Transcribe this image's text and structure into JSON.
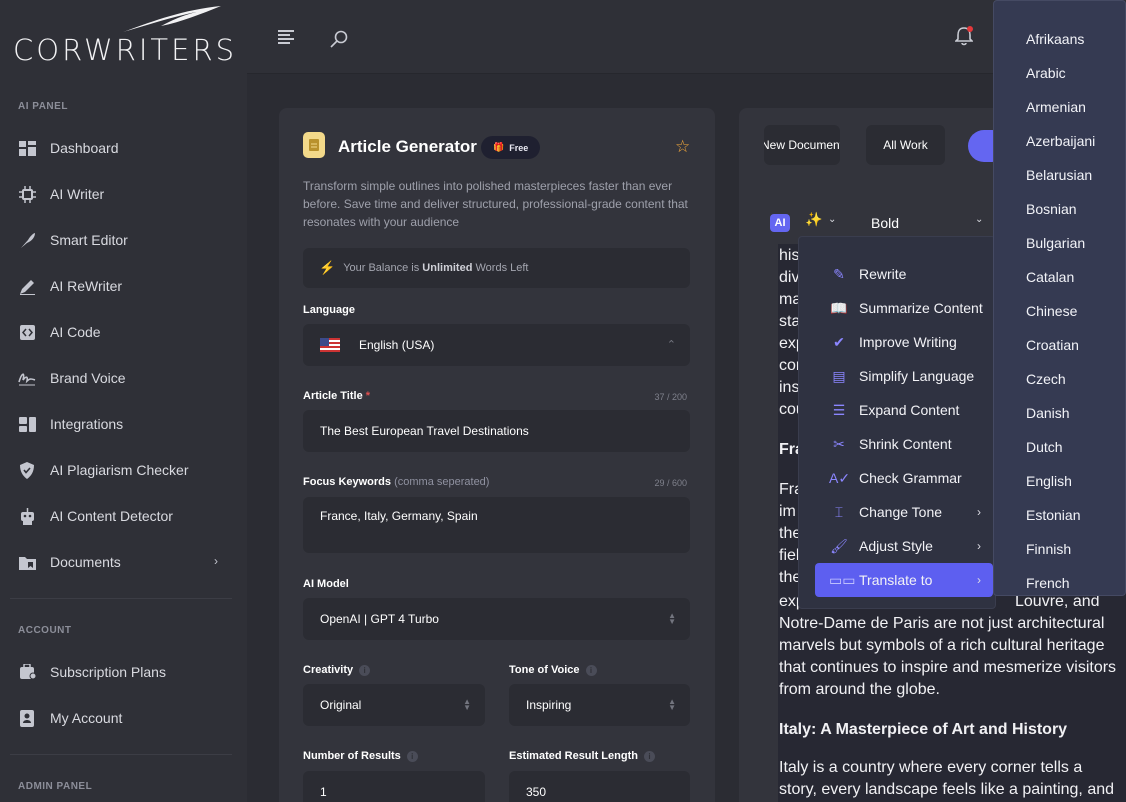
{
  "brand": {
    "name": "CORWRITERS"
  },
  "sidebar": {
    "sections": {
      "ai_panel": "AI PANEL",
      "account": "ACCOUNT",
      "admin_panel": "ADMIN PANEL"
    },
    "items": [
      {
        "label": "Dashboard",
        "icon": "dashboard-icon"
      },
      {
        "label": "AI Writer",
        "icon": "chip-icon"
      },
      {
        "label": "Smart Editor",
        "icon": "feather-icon"
      },
      {
        "label": "AI ReWriter",
        "icon": "pen-icon"
      },
      {
        "label": "AI Code",
        "icon": "code-icon"
      },
      {
        "label": "Brand Voice",
        "icon": "signature-icon"
      },
      {
        "label": "Integrations",
        "icon": "integrations-icon"
      },
      {
        "label": "AI Plagiarism Checker",
        "icon": "shield-icon"
      },
      {
        "label": "AI Content Detector",
        "icon": "robot-icon"
      },
      {
        "label": "Documents",
        "icon": "folder-icon"
      }
    ],
    "account_items": [
      {
        "label": "Subscription Plans",
        "icon": "plans-icon"
      },
      {
        "label": "My Account",
        "icon": "account-icon"
      }
    ]
  },
  "generator": {
    "title": "Article Generator",
    "badge": "Free",
    "description": "Transform simple outlines into polished masterpieces faster than ever before. Save time and deliver structured, professional-grade content that resonates with your audience",
    "balance": {
      "prefix": "Your Balance is",
      "amount": "Unlimited",
      "suffix": "Words Left"
    },
    "language": {
      "label": "Language",
      "value": "English (USA)"
    },
    "article_title": {
      "label": "Article Title",
      "required": "*",
      "count": "37 / 200",
      "value": "The Best European Travel Destinations"
    },
    "focus_keywords": {
      "label": "Focus Keywords",
      "hint": "(comma seperated)",
      "count": "29 / 600",
      "value": "France, Italy, Germany, Spain"
    },
    "ai_model": {
      "label": "AI Model",
      "value": "OpenAI | GPT 4 Turbo"
    },
    "creativity": {
      "label": "Creativity",
      "value": "Original"
    },
    "tone": {
      "label": "Tone of Voice",
      "value": "Inspiring"
    },
    "num_results": {
      "label": "Number of Results",
      "value": "1"
    },
    "result_length": {
      "label": "Estimated Result Length",
      "value": "350"
    }
  },
  "editor": {
    "buttons": {
      "new_doc": "New Document",
      "all_work": "All Work"
    },
    "ai_badge": "AI",
    "format_select": "Bold",
    "lines_top": [
      "his",
      "div",
      "ma",
      "sta",
      "exp",
      "cor",
      "ins",
      "cou"
    ],
    "heading_france": "Fra",
    "lines_france": [
      "Fra",
      "im",
      "the",
      "fiel",
      "the"
    ],
    "line_exp": "exp",
    "line_louvre": "Louvre, and",
    "para_rest": [
      "Notre-Dame de Paris are not just architectural",
      "marvels but symbols of a rich cultural heritage",
      "that continues to inspire and mesmerize visitors",
      "from around the globe."
    ],
    "heading_italy": "Italy: A Masterpiece of Art and History",
    "para_italy": [
      "Italy is a country where every corner tells a",
      "story, every landscape feels like a painting, and"
    ]
  },
  "context_menu": [
    {
      "label": "Rewrite",
      "icon": "rewrite-icon"
    },
    {
      "label": "Summarize Content",
      "icon": "book-icon"
    },
    {
      "label": "Improve Writing",
      "icon": "check-double-icon"
    },
    {
      "label": "Simplify Language",
      "icon": "document-icon"
    },
    {
      "label": "Expand Content",
      "icon": "expand-icon"
    },
    {
      "label": "Shrink Content",
      "icon": "scissors-icon"
    },
    {
      "label": "Check Grammar",
      "icon": "grammar-icon"
    },
    {
      "label": "Change Tone",
      "icon": "tone-icon",
      "submenu": true
    },
    {
      "label": "Adjust Style",
      "icon": "brush-icon",
      "submenu": true
    },
    {
      "label": "Translate to",
      "icon": "translate-icon",
      "submenu": true,
      "active": true
    }
  ],
  "languages": [
    "Afrikaans",
    "Arabic",
    "Armenian",
    "Azerbaijani",
    "Belarusian",
    "Bosnian",
    "Bulgarian",
    "Catalan",
    "Chinese",
    "Croatian",
    "Czech",
    "Danish",
    "Dutch",
    "English",
    "Estonian",
    "Finnish",
    "French"
  ],
  "colors": {
    "accent": "#6466f1",
    "star": "#f0a63b",
    "notification": "#e5383b"
  }
}
